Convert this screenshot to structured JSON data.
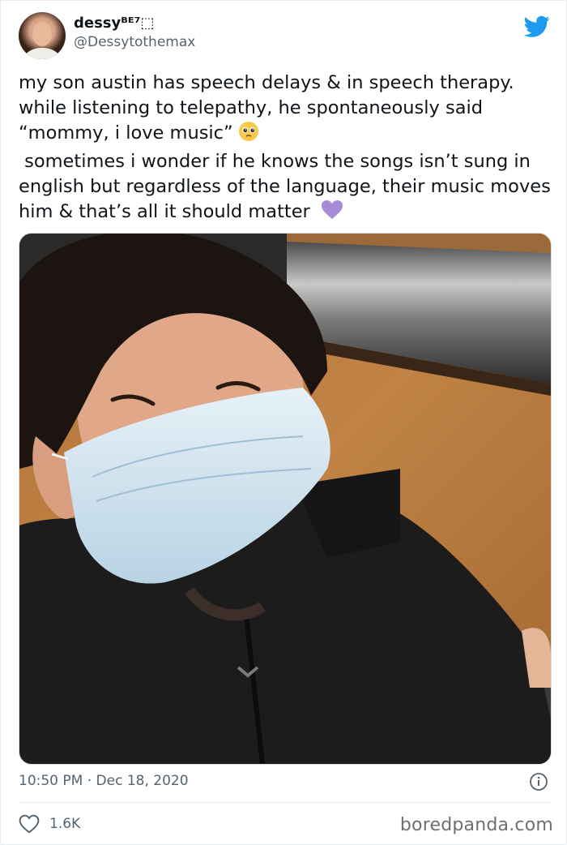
{
  "tweet": {
    "display_name": "dessyᴮᴱ⁷⬚",
    "handle": "@Dessytothemax",
    "text_part1": "my son austin has speech delays & in speech therapy. while listening to telepathy, he spontaneously said “mommy, i love music”",
    "text_part2": "\n sometimes i wonder if he knows the songs isn’t sung in english but regardless of the language, their music moves him & that’s all it should matter ",
    "timestamp": "10:50 PM · Dec 18, 2020",
    "likes": "1.6K"
  },
  "watermark": "boredpanda.com",
  "icons": {
    "brand": "twitter-bird-icon",
    "emoji1": "pleading-face-emoji-icon",
    "emoji2": "purple-heart-emoji-icon",
    "info": "info-icon",
    "like": "heart-outline-icon"
  },
  "colors": {
    "twitter_blue": "#1d9bf0",
    "text": "#0f1419",
    "muted": "#536471",
    "purple_heart": "#a78bd8"
  }
}
